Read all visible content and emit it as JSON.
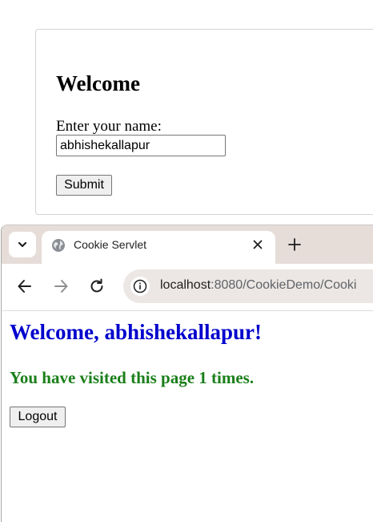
{
  "form": {
    "heading": "Welcome",
    "label": "Enter your name:",
    "name_value": "abhishekallapur",
    "submit_label": "Submit"
  },
  "browser": {
    "tab": {
      "title": "Cookie Servlet",
      "favicon": "globe-icon"
    },
    "url": {
      "host": "localhost",
      "rest": ":8080/CookieDemo/Cooki"
    },
    "icons": {
      "tab_menu": "chevron-down-icon",
      "close": "close-icon",
      "new_tab": "plus-icon",
      "back": "arrow-left-icon",
      "forward": "arrow-right-icon",
      "reload": "reload-icon",
      "site_info": "info-icon"
    }
  },
  "page": {
    "welcome": "Welcome, abhishekallapur!",
    "visits": "You have visited this page 1 times.",
    "logout_label": "Logout"
  },
  "colors": {
    "welcome_text": "#0000cd",
    "visits_text": "#1a7f1a",
    "tabstrip_bg": "#e6ddd8",
    "omnibox_bg": "#ece7e4"
  }
}
